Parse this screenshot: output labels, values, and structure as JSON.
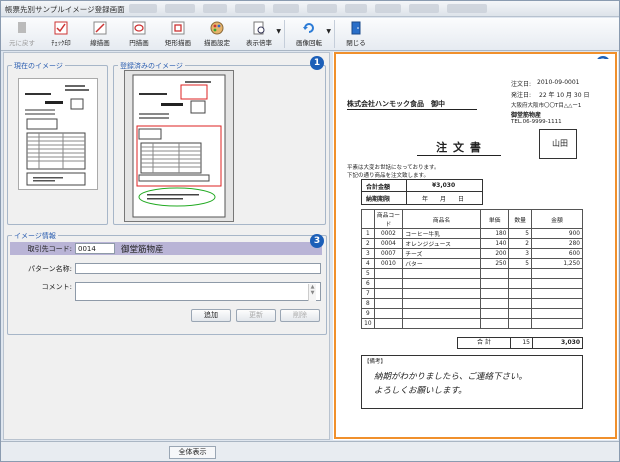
{
  "window": {
    "title": "帳票先別サンプルイメージ登録画面"
  },
  "toolbar": {
    "buttons": [
      {
        "label": "元に戻す"
      },
      {
        "label": "ﾁｪｯｸ印"
      },
      {
        "label": "線描画"
      },
      {
        "label": "円描画"
      },
      {
        "label": "矩形描画"
      },
      {
        "label": "描画設定"
      },
      {
        "label": "表示倍率"
      },
      {
        "label": "画像回転"
      },
      {
        "label": "閉じる"
      }
    ]
  },
  "left": {
    "current_image_label": "現在のイメージ",
    "registered_image_label": "登録済みのイメージ",
    "image_info_label": "イメージ情報",
    "customer_code_label": "取引先コード:",
    "customer_code_value": "0014",
    "customer_name": "御堂筋物産",
    "pattern_label": "パターン名称:",
    "pattern_value": "",
    "comment_label": "コメント:",
    "comment_value": "",
    "add_label": "追加",
    "update_label": "更新",
    "delete_label": "削除"
  },
  "badges": {
    "one": "1",
    "two": "2",
    "three": "3"
  },
  "status": {
    "full_view_label": "全体表示"
  },
  "document": {
    "date_label": "注文日:",
    "date_value": "2010-09-0001",
    "issue_label": "発注日:",
    "issue_value": "22 年 10 月 30 日",
    "addr": "大阪府大阪市〇〇T目△△ー1",
    "sender": "御堂筋物産",
    "tel": "TEL.06-9999-1111",
    "recipient": "株式会社ハンモック食品　御中",
    "heading": "注 文 書",
    "stamp": "山田",
    "intro1": "平素は大変お世話になっております。",
    "intro2": "下記の通り商品を注文致します。",
    "total_label": "合計金額",
    "total_value": "¥3,030",
    "deadline_label": "納期期限",
    "deadline_value": "年　　月　　日",
    "headers": [
      "",
      "商品コード",
      "商品名",
      "単価",
      "数量",
      "金額"
    ],
    "rows": [
      [
        "1",
        "0002",
        "コーヒー牛乳",
        "180",
        "5",
        "900"
      ],
      [
        "2",
        "0004",
        "オレンジジュース",
        "140",
        "2",
        "280"
      ],
      [
        "3",
        "0007",
        "チーズ",
        "200",
        "3",
        "600"
      ],
      [
        "4",
        "0010",
        "バター",
        "250",
        "5",
        "1,250"
      ],
      [
        "5",
        "",
        "",
        "",
        "",
        ""
      ],
      [
        "6",
        "",
        "",
        "",
        "",
        ""
      ],
      [
        "7",
        "",
        "",
        "",
        "",
        ""
      ],
      [
        "8",
        "",
        "",
        "",
        "",
        ""
      ],
      [
        "9",
        "",
        "",
        "",
        "",
        ""
      ],
      [
        "10",
        "",
        "",
        "",
        "",
        ""
      ]
    ],
    "sum_label": "合 計",
    "sum_qty": "15",
    "sum_amount": "3,030",
    "remarks_label": "【備考】",
    "handwriting1": "納期がわかりましたら、ご連絡下さい。",
    "handwriting2": "よろしくお願いします。"
  }
}
